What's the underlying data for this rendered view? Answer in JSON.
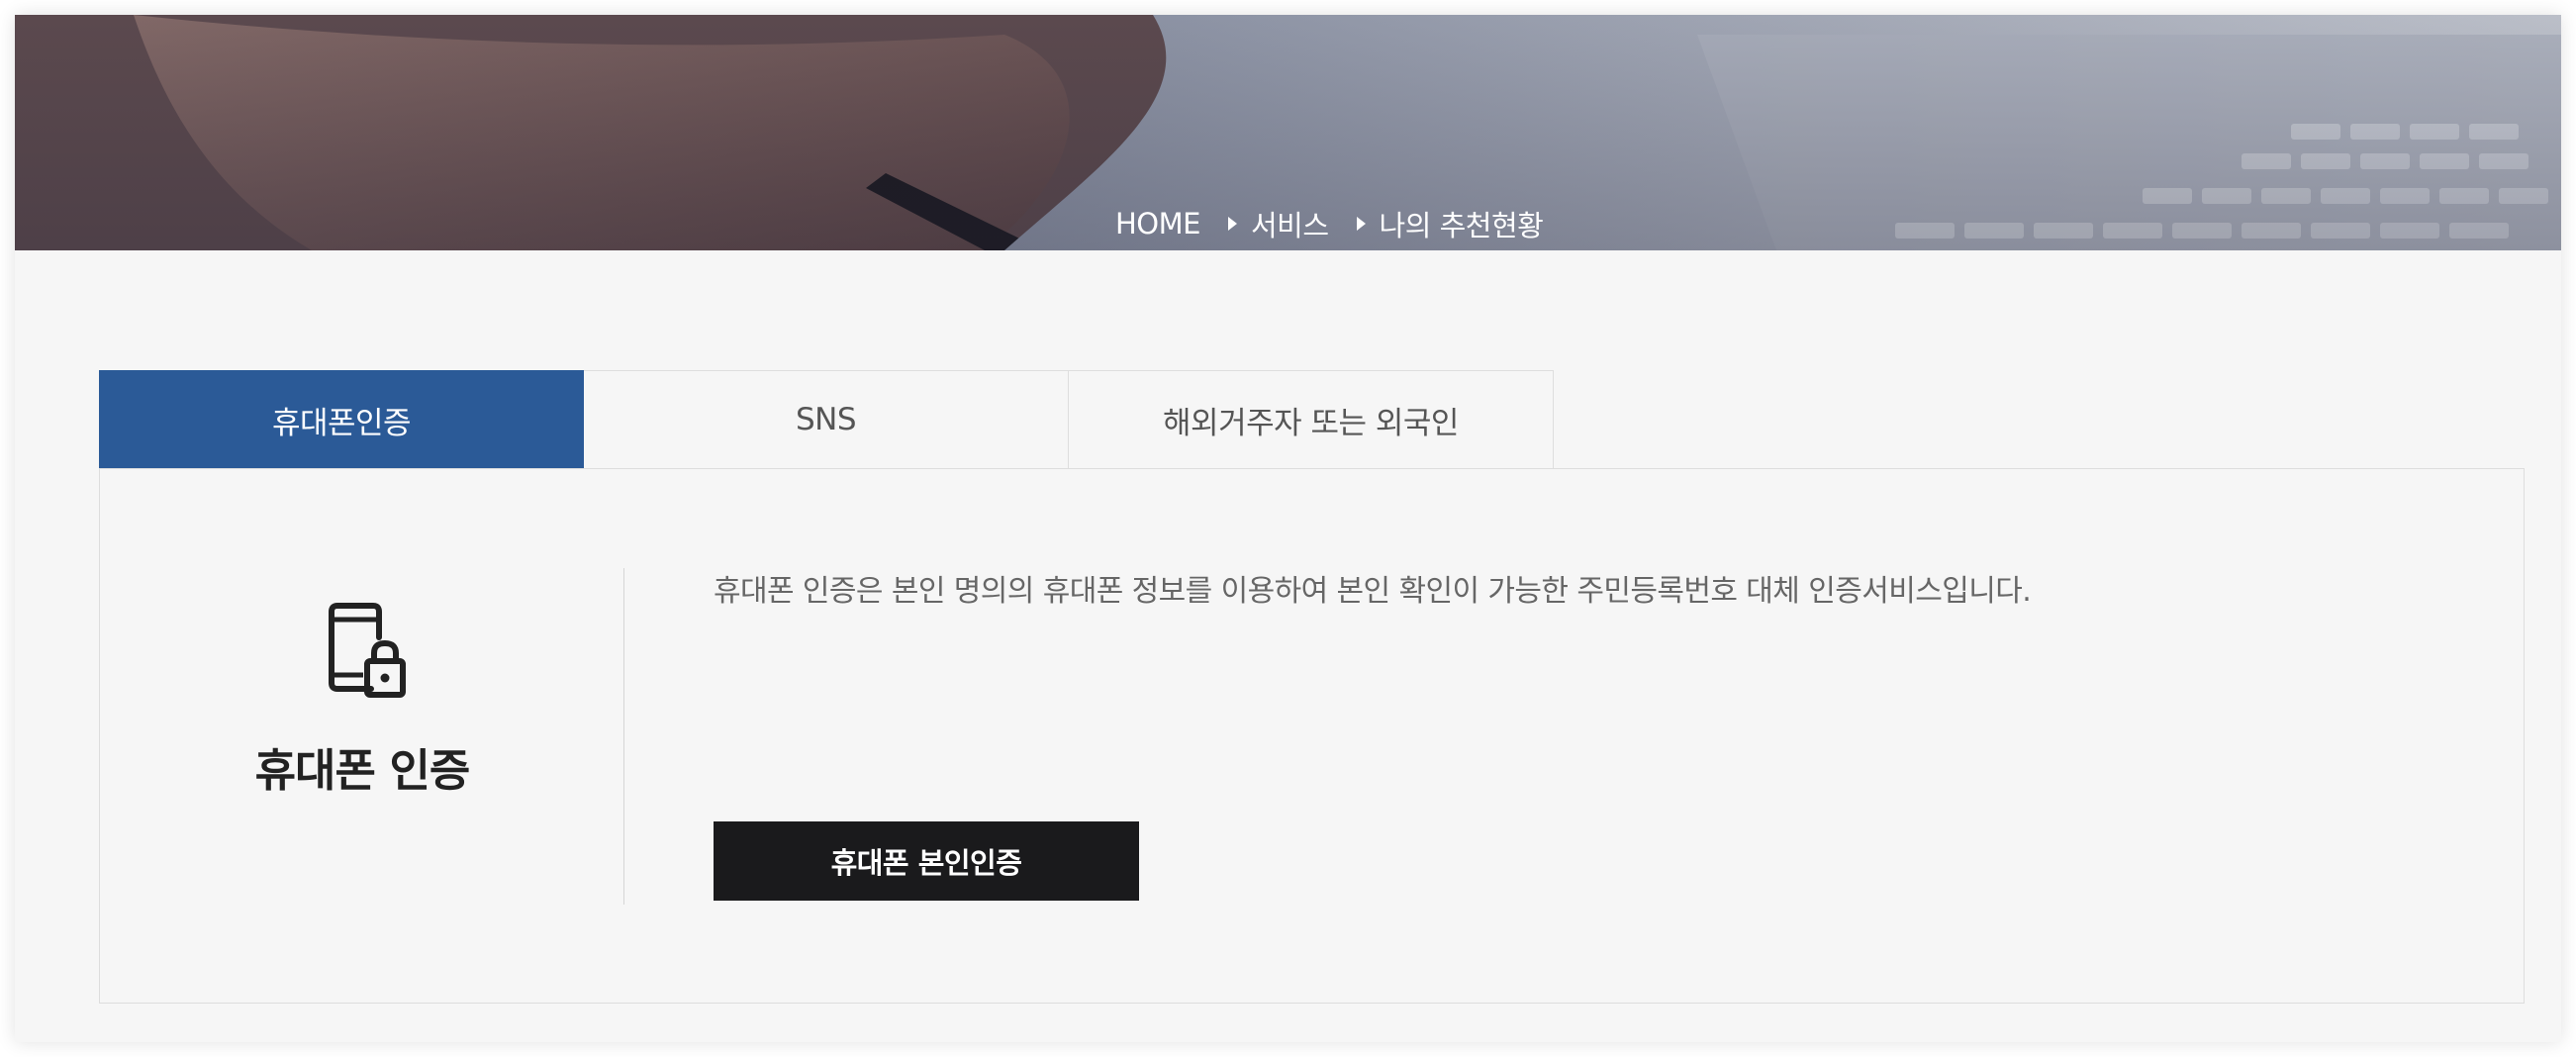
{
  "breadcrumb": {
    "home": "HOME",
    "level1": "서비스",
    "level2": "나의 추천현황"
  },
  "tabs": [
    {
      "label": "휴대폰인증",
      "active": true
    },
    {
      "label": "SNS",
      "active": false
    },
    {
      "label": "해외거주자 또는 외국인",
      "active": false
    }
  ],
  "panel": {
    "icon": "phone-lock-icon",
    "title": "휴대폰 인증",
    "description": "휴대폰 인증은 본인 명의의 휴대폰 정보를 이용하여 본인 확인이 가능한 주민등록번호 대체 인증서비스입니다.",
    "button_label": "휴대폰 본인인증"
  },
  "colors": {
    "active_tab": "#2b5a97",
    "button_bg": "#1a1a1c",
    "page_bg": "#f6f6f6"
  }
}
